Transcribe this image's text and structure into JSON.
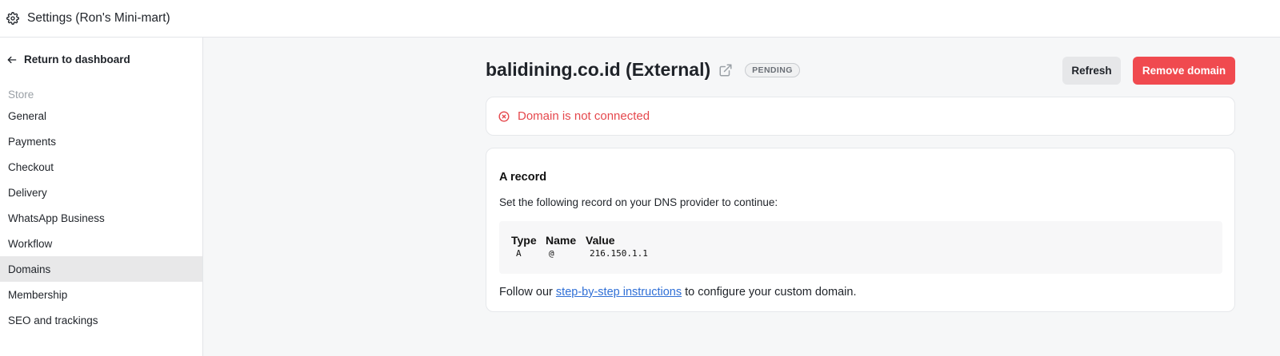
{
  "topbar": {
    "title": "Settings (Ron's Mini-mart)",
    "icon": "gear-icon"
  },
  "sidebar": {
    "back_label": "Return to dashboard",
    "section_label": "Store",
    "items": [
      {
        "label": "General",
        "active": false
      },
      {
        "label": "Payments",
        "active": false
      },
      {
        "label": "Checkout",
        "active": false
      },
      {
        "label": "Delivery",
        "active": false
      },
      {
        "label": "WhatsApp Business",
        "active": false
      },
      {
        "label": "Workflow",
        "active": false
      },
      {
        "label": "Domains",
        "active": true
      },
      {
        "label": "Membership",
        "active": false
      },
      {
        "label": "SEO and trackings",
        "active": false
      }
    ]
  },
  "domain": {
    "title": "balidining.co.id (External)",
    "status_badge": "PENDING",
    "refresh_label": "Refresh",
    "remove_label": "Remove domain"
  },
  "alert": {
    "text": "Domain is not connected",
    "color": "#e5484d"
  },
  "record": {
    "title": "A record",
    "description": "Set the following record on your DNS provider to continue:",
    "headers": {
      "type": "Type",
      "name": "Name",
      "value": "Value"
    },
    "row": {
      "type": "A",
      "name": "@",
      "value": "216.150.1.1"
    },
    "follow_prefix": "Follow our ",
    "follow_link": "step-by-step instructions",
    "follow_suffix": " to configure your custom domain."
  },
  "colors": {
    "danger": "#f04a4f",
    "link": "#2f6fd6",
    "active_nav": "#e8e8e9"
  }
}
